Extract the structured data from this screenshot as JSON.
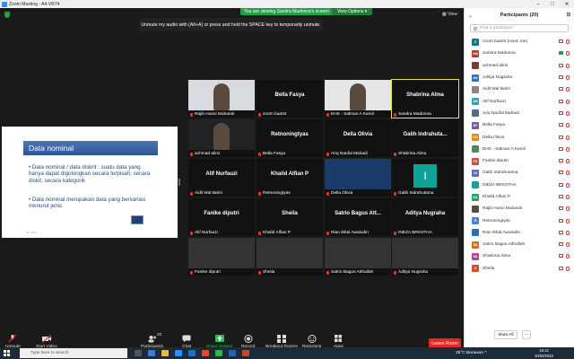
{
  "window": {
    "title": "Zoom Meeting - A4-VR74"
  },
  "banner": {
    "viewing": "You are viewing Sandra Madonna's screen",
    "view_options": "View Options ▾"
  },
  "tip": "Unmute my audio with (Alt+A) or press and hold the SPACE key to temporarily unmute.",
  "view_label": "▦ View",
  "slide": {
    "title": "Data nominal",
    "bullet1": "Data nominal / data diskrit : suatu data yang hanya dapat digolongkan secara terpisah, secara diskit, secara kategorik",
    "bullet2": "Data nominal merupakan data yang bervariasi menurut jenis",
    "footer": "H / 15 H"
  },
  "tiles": [
    "Rajib Husni Mubarok",
    "zoom baa04",
    "EHS - Salman A Kamil",
    "Sandra Madonna",
    "achmad alimi",
    "Bella Fasya",
    "Ariq Naufal Mahadi",
    "Shabrina Alma",
    "Aidil Wal Bahri",
    "Retnoningtyas",
    "Della Olivia",
    "Galih Indrahutama",
    "Alif Nurfauzi",
    "Khalid Alfian P",
    "Rian Ikbal Awaludin",
    "INEZA BRIGITHA",
    "Fanike diputri",
    "Sheila",
    "Satrio Bagus Atthallah",
    "Aditya Nugraha"
  ],
  "tile_big_names": {
    "1": "Bella Fasya",
    "3": "Shabrina Alma",
    "5": "Retnoningtyas",
    "6": "Della Olivia",
    "7": "Galih Indrahuta...",
    "8": "Alif Nurfauzi",
    "9": "Khalid Alfian P",
    "12": "Fanike diputri",
    "13": "Sheila",
    "14": "Satrio Bagus Att...",
    "15": "Aditya Nugraha"
  },
  "toolbar": {
    "unmute": "Unmute",
    "start_video": "Start Video",
    "participants": "Participants",
    "participants_count": "20",
    "chat": "Chat",
    "share_screen": "Share Screen",
    "record": "Record",
    "breakout": "Breakout Rooms",
    "reactions": "Reactions",
    "apps": "Apps",
    "leave": "Leave Room"
  },
  "panel": {
    "title": "Participants (20)",
    "search_placeholder": "Find a participant",
    "mute_all": "Mute All",
    "participants": [
      {
        "initials": "Z",
        "name": "zoom baa04 (Host, me)",
        "color": "#0f7a8a"
      },
      {
        "initials": "SM",
        "name": "Sandra Madonna",
        "color": "#c0392b"
      },
      {
        "initials": "",
        "name": "achmad alimi",
        "color": "#7a3b2e"
      },
      {
        "initials": "AN",
        "name": "Aditya Nugraha",
        "color": "#2f6fd1"
      },
      {
        "initials": "",
        "name": "Aidil Wal Bahri",
        "color": "#888888"
      },
      {
        "initials": "AN",
        "name": "Alif Nurfauzi",
        "color": "#2aa6b5"
      },
      {
        "initials": "",
        "name": "Ariq Naufal Mahadi",
        "color": "#556b8a"
      },
      {
        "initials": "BF",
        "name": "Bella Fasya",
        "color": "#6f5aa8"
      },
      {
        "initials": "DO",
        "name": "Della Olivia",
        "color": "#e08a1e"
      },
      {
        "initials": "",
        "name": "EHS - Salman A Kamil",
        "color": "#4a8a5a"
      },
      {
        "initials": "FD",
        "name": "Fanike diputri",
        "color": "#d14a3a"
      },
      {
        "initials": "GI",
        "name": "Galih Indrahutama",
        "color": "#5b6cc2"
      },
      {
        "initials": "",
        "name": "INEZA BRIGITHA",
        "color": "#0fa39a"
      },
      {
        "initials": "KA",
        "name": "Khalid Alfian P",
        "color": "#27a06b"
      },
      {
        "initials": "",
        "name": "Rajib Husni Mubarok",
        "color": "#5a4a3a"
      },
      {
        "initials": "R",
        "name": "Retnoningtyas",
        "color": "#3f86d9"
      },
      {
        "initials": "",
        "name": "Rian Ikbal Awaludin",
        "color": "#2b6fb0"
      },
      {
        "initials": "SA",
        "name": "Satrio Bagus Atthallah",
        "color": "#e06a1e"
      },
      {
        "initials": "SA",
        "name": "Shabrina Alma",
        "color": "#b0459a"
      },
      {
        "initials": "S",
        "name": "Sheila",
        "color": "#e04a1e"
      }
    ]
  },
  "taskbar": {
    "search": "Type here to search",
    "weather": "25°C  Berawan  ^",
    "time": "19:12",
    "date": "10/03/2022"
  }
}
